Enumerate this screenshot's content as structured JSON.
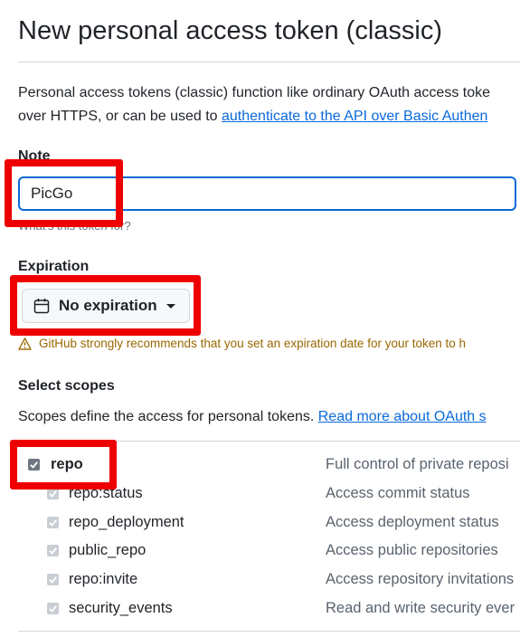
{
  "page": {
    "title": "New personal access token (classic)",
    "description_line1": "Personal access tokens (classic) function like ordinary OAuth access toke",
    "description_line2_prefix": "over HTTPS, or can be used to ",
    "description_link": "authenticate to the API over Basic Authen"
  },
  "note": {
    "label": "Note",
    "value": "PicGo",
    "help": "What's this token for?"
  },
  "expiration": {
    "label": "Expiration",
    "selected": "No expiration",
    "icon": "calendar-icon",
    "warning": "GitHub strongly recommends that you set an expiration date for your token to h"
  },
  "scopes": {
    "label": "Select scopes",
    "description_prefix": "Scopes define the access for personal tokens. ",
    "description_link": "Read more about OAuth s",
    "items": [
      {
        "name": "repo",
        "description": "Full control of private reposi",
        "checked": true
      },
      {
        "name": "repo:status",
        "description": "Access commit status",
        "checked": true
      },
      {
        "name": "repo_deployment",
        "description": "Access deployment status",
        "checked": true
      },
      {
        "name": "public_repo",
        "description": "Access public repositories",
        "checked": true
      },
      {
        "name": "repo:invite",
        "description": "Access repository invitations",
        "checked": true
      },
      {
        "name": "security_events",
        "description": "Read and write security ever",
        "checked": true
      }
    ]
  },
  "colors": {
    "link": "#0969da",
    "warning": "#9a6700",
    "highlight": "#ee0000"
  }
}
